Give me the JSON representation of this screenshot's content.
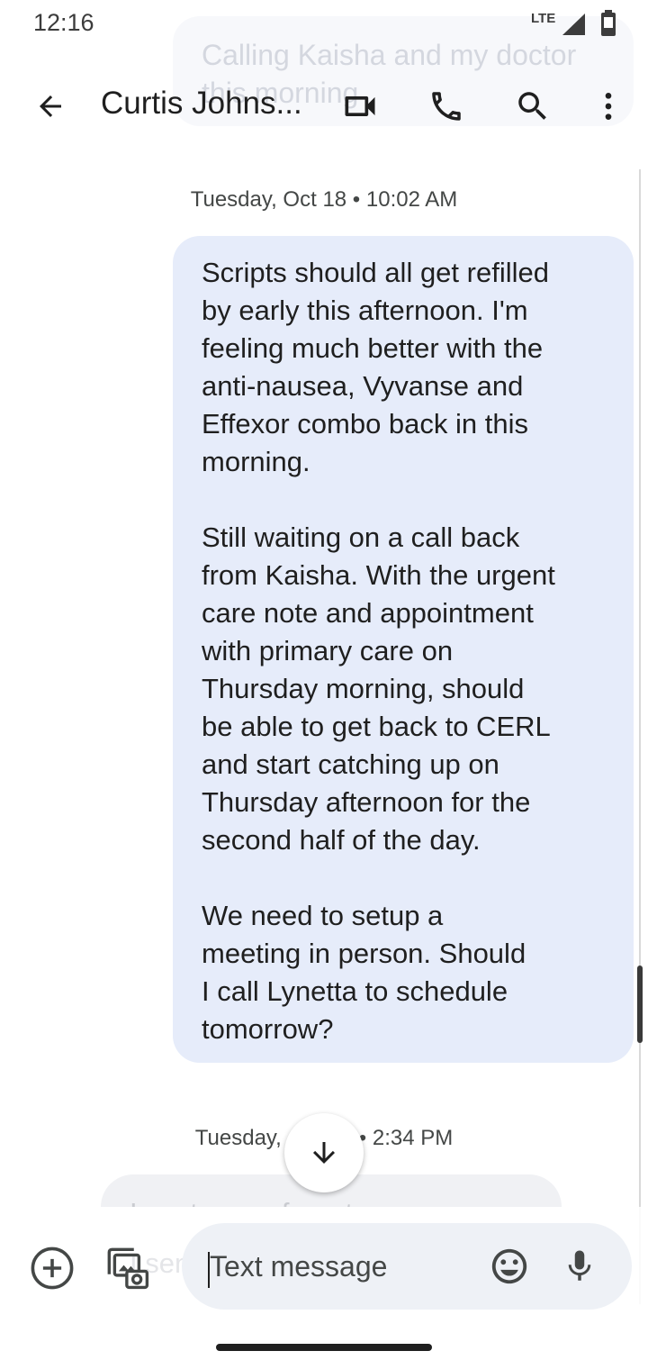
{
  "status_bar": {
    "time": "12:16",
    "network": "LTE",
    "signal_icon": "cell-signal-icon",
    "battery_icon": "battery-icon"
  },
  "ghost_preview": {
    "top_text": "Calling Kaisha and my doctor this morning",
    "bottom_text": "I sent you a form to your email"
  },
  "header": {
    "contact_name": "Curtis Johns...",
    "back_icon": "arrow-back-icon",
    "video_icon": "video-call-icon",
    "call_icon": "phone-icon",
    "search_icon": "search-icon",
    "more_icon": "more-vert-icon"
  },
  "conversation": {
    "timestamp_1": "Tuesday, Oct 18 • 10:02 AM",
    "outgoing_message": "Scripts should all get refilled\nby early this afternoon. I'm\nfeeling much better with the\nanti-nausea, Vyvanse and\nEffexor combo back in this\nmorning.\n\nStill waiting on a call back\nfrom Kaisha. With the urgent\ncare note and appointment\nwith primary care on\nThursday morning, should\nbe able to get back to CERL\nand start catching up on\nThursday afternoon for the\nsecond half of the day.\n\nWe need to setup a\nmeeting in person. Should\nI call Lynetta to schedule\ntomorrow?",
    "timestamp_2_start": "Tuesday,",
    "timestamp_2_end": "• 2:34 PM",
    "incoming_message_preview": "I sent you a form to your",
    "jump_icon": "arrow-down-icon"
  },
  "compose": {
    "placeholder": "Text message",
    "add_icon": "add-circle-icon",
    "gallery_icon": "gallery-camera-icon",
    "emoji_icon": "emoji-icon",
    "mic_icon": "mic-icon"
  },
  "colors": {
    "outgoing_bubble": "#e6ecfa",
    "incoming_bubble": "#f0f1f4",
    "compose_field": "#eef1f6",
    "icon": "#444746"
  }
}
